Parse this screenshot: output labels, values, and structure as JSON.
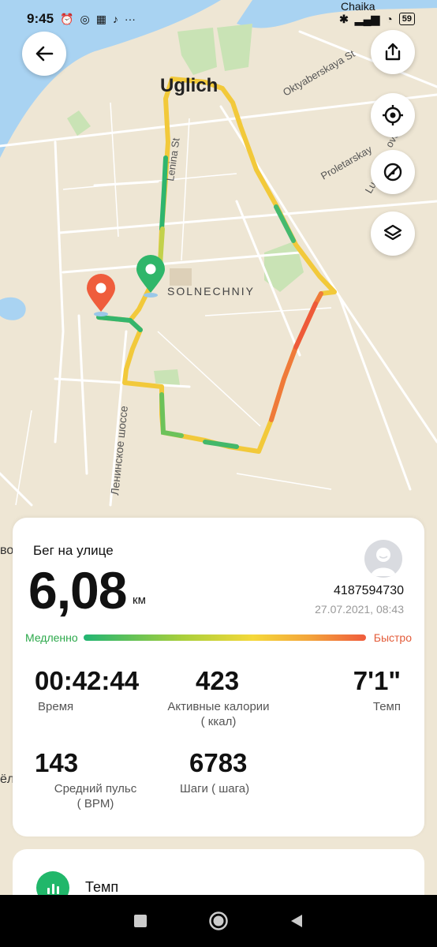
{
  "status_bar": {
    "time": "9:45",
    "carrier": "Chaika",
    "battery": "59"
  },
  "map": {
    "labels": {
      "town": "Uglich",
      "street_oktyaberskaya": "Oktyaberskaya St",
      "street_proletarskay": "Proletarskay",
      "street_ovo": "ovo St",
      "street_lu": "Lu",
      "street_lenina": "Lenina St",
      "poi_solnechniy": "SOLNECHNIY",
      "street_leninskoe": "Ленинское шоссе",
      "edge_vo": "во",
      "edge_el": "ёл"
    }
  },
  "colors": {
    "accent_green": "#21b76a",
    "start_pin": "#2fb66a",
    "end_pin": "#ef5d3c"
  },
  "activity": {
    "type": "Бег на улице",
    "distance": "6,08",
    "distance_unit": "км",
    "user_id": "4187594730",
    "datetime": "27.07.2021, 08:43",
    "pace_slow_label": "Медленно",
    "pace_fast_label": "Быстро"
  },
  "stats": {
    "time": {
      "value": "00:42:44",
      "label": "Время"
    },
    "calories": {
      "value": "423",
      "label": "Активные калории",
      "unit": "( ккал)"
    },
    "pace": {
      "value": "7'1\"",
      "label": "Темп"
    },
    "heart_rate": {
      "value": "143",
      "label": "Средний пульс",
      "unit": "( BPM)"
    },
    "steps": {
      "value": "6783",
      "label": "Шаги ( шага)"
    }
  },
  "section": {
    "tempo_label": "Темп"
  },
  "icons": {
    "back": "arrow-left-icon",
    "share": "share-icon",
    "locate": "target-icon",
    "hide_route": "route-off-icon",
    "layers": "layers-icon",
    "tempo": "bar-chart-icon"
  }
}
